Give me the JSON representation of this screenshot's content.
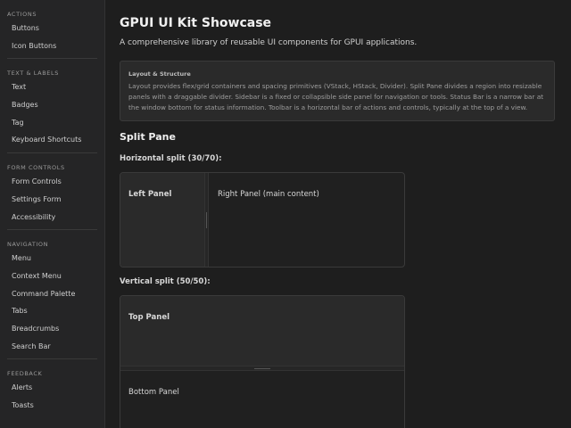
{
  "sidebar": {
    "sections": [
      {
        "header": "ACTIONS",
        "items": [
          "Buttons",
          "Icon Buttons"
        ]
      },
      {
        "header": "TEXT & LABELS",
        "items": [
          "Text",
          "Badges",
          "Tag",
          "Keyboard Shortcuts"
        ]
      },
      {
        "header": "FORM CONTROLS",
        "items": [
          "Form Controls",
          "Settings Form",
          "Accessibility"
        ]
      },
      {
        "header": "NAVIGATION",
        "items": [
          "Menu",
          "Context Menu",
          "Command Palette",
          "Tabs",
          "Breadcrumbs",
          "Search Bar"
        ]
      },
      {
        "header": "FEEDBACK",
        "items": [
          "Alerts",
          "Toasts"
        ]
      }
    ]
  },
  "main": {
    "title": "GPUI UI Kit Showcase",
    "subtitle": "A comprehensive library of reusable UI components for GPUI applications.",
    "info": {
      "title": "Layout & Structure",
      "text": "Layout provides flex/grid containers and spacing primitives (VStack, HStack, Divider). Split Pane divides a region into resizable panels with a draggable divider. Sidebar is a fixed or collapsible side panel for navigation or tools. Status Bar is a narrow bar at the window bottom for status information. Toolbar is a horizontal bar of actions and controls, typically at the top of a view."
    },
    "section_title": "Split Pane",
    "horizontal": {
      "label": "Horizontal split (30/70):",
      "left": "Left Panel",
      "right": "Right Panel (main content)"
    },
    "vertical": {
      "label": "Vertical split (50/50):",
      "top": "Top Panel",
      "bottom": "Bottom Panel"
    }
  }
}
